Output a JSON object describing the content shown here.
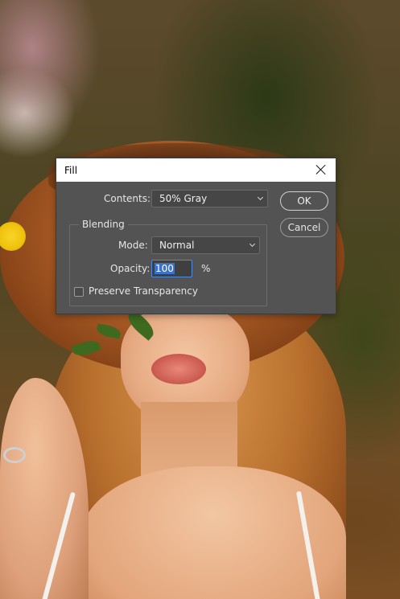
{
  "dialog": {
    "title": "Fill",
    "contents_label": "Contents:",
    "contents_value": "50% Gray",
    "blending": {
      "title": "Blending",
      "mode_label": "Mode:",
      "mode_value": "Normal",
      "opacity_label": "Opacity:",
      "opacity_value": "100",
      "opacity_unit": "%",
      "preserve_transparency_label": "Preserve Transparency",
      "preserve_transparency_checked": false
    },
    "ok_label": "OK",
    "cancel_label": "Cancel"
  },
  "icons": {
    "close": "close-icon",
    "dropdown": "chevron-down-icon"
  },
  "colors": {
    "dialog_bg": "#535353",
    "field_bg": "#464646",
    "focus_border": "#4f8bdc",
    "selection": "#3c73c8"
  }
}
